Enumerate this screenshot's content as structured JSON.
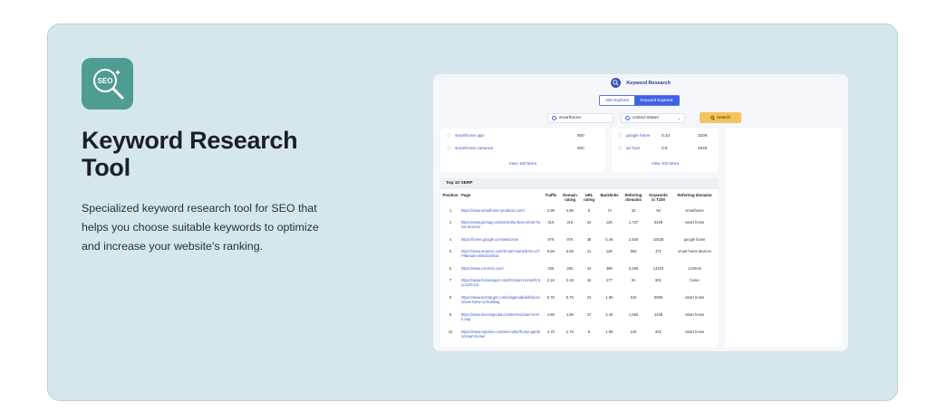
{
  "marketing": {
    "title": "Keyword Research Tool",
    "description": "Specialized keyword research tool for SEO that helps you choose suitable keywords to optimize and increase your website's ranking.",
    "logo_text": "SEO"
  },
  "app": {
    "title": "Keyword Research",
    "tabs": [
      {
        "label": "Site Explorer",
        "active": false
      },
      {
        "label": "Keyword Explorer",
        "active": true
      }
    ],
    "search": {
      "keyword_value": "smarthome",
      "country_value": "United States",
      "button_label": "Search"
    },
    "left_keywords": {
      "rows": [
        {
          "keyword": "smarthome app",
          "volume": "800"
        },
        {
          "keyword": "smarthome cameras",
          "volume": "500"
        }
      ],
      "more_label": "View 100 More"
    },
    "right_keywords": {
      "rows": [
        {
          "keyword": "google home",
          "kd": "0.33",
          "volume": "320K"
        },
        {
          "keyword": "air fryer",
          "kd": "0.8",
          "volume": "292K"
        }
      ],
      "more_label": "View 100 More"
    },
    "serp": {
      "title": "Top 10 SERP",
      "columns": [
        "Position",
        "Page",
        "Traffic",
        "Domain rating",
        "URL rating",
        "Backlinks",
        "Referring domains",
        "Keywords in T100",
        "Referring domains"
      ],
      "rows": [
        [
          "1",
          "https://www.smarthome-products.com/",
          "2.9K",
          "3.9K",
          "5",
          "74",
          "32",
          "93",
          "smarthome"
        ],
        [
          "2",
          "https://www.pcmag.com/picks/the-best-smart-home-devices",
          "31K",
          "31K",
          "44",
          "12K",
          "1,737",
          "5438",
          "smart home"
        ],
        [
          "4",
          "https://home.google.com/welcome/",
          "97K",
          "97K",
          "38",
          "5.4K",
          "2,500",
          "10638",
          "google home"
        ],
        [
          "5",
          "https://www.amazon.com/Smart-Home/b?ie=UTF8&node=6563140011",
          "6.6K",
          "6.6K",
          "41",
          "12K",
          "863",
          "371",
          "smart home devices"
        ],
        [
          "6",
          "https://www.control4.com/",
          "25K",
          "25K",
          "44",
          "39K",
          "5,269",
          "13420",
          "control4"
        ],
        [
          "7",
          "https://www.homedepot.com/b/Smart-Home/N-5yc1vZc1ov",
          "2.1K",
          "2.1K",
          "15",
          "277",
          "91",
          "801",
          "home"
        ],
        [
          "8",
          "https://www.techtarget.com/iotagenda/definition/smart-home-or-building",
          "5.7K",
          "5.7K",
          "34",
          "1.9K",
          "610",
          "5085",
          "smart home"
        ],
        [
          "9",
          "https://www.investopedia.com/terms/smart-home.asp",
          "4.8K",
          "4.8K",
          "37",
          "2.4K",
          "1,060",
          "2438",
          "smart home"
        ],
        [
          "10",
          "https://www.nytimes.com/wirecutter/home-garden/smart-home/",
          "2.7K",
          "2.7K",
          "9",
          "1.8K",
          "12K",
          "922",
          "smart home"
        ]
      ]
    }
  },
  "colors": {
    "card_bg": "#d5e7ea",
    "logo_bg": "#4f9c93",
    "accent": "#3d63e6",
    "search_button": "#f5c45d"
  }
}
